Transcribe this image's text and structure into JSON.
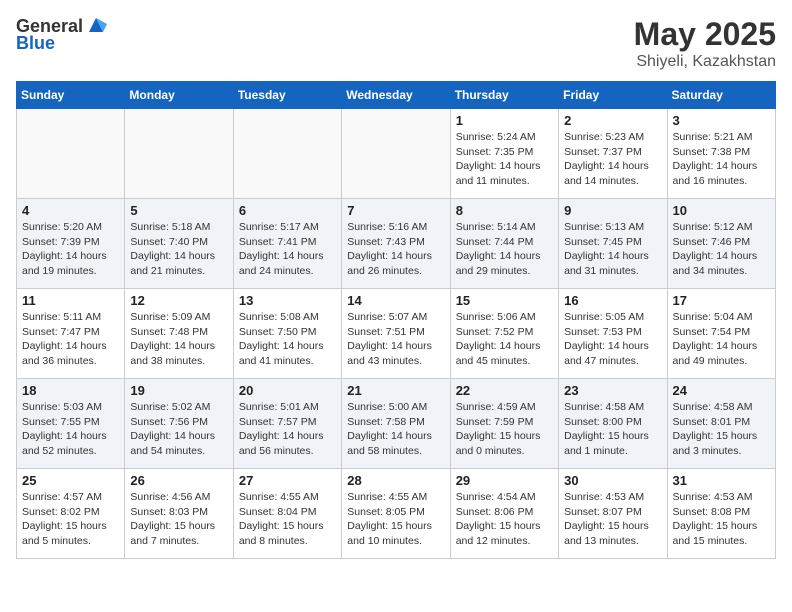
{
  "logo": {
    "text_general": "General",
    "text_blue": "Blue"
  },
  "title": "May 2025",
  "subtitle": "Shiyeli, Kazakhstan",
  "days_of_week": [
    "Sunday",
    "Monday",
    "Tuesday",
    "Wednesday",
    "Thursday",
    "Friday",
    "Saturday"
  ],
  "weeks": [
    [
      {
        "day": "",
        "info": ""
      },
      {
        "day": "",
        "info": ""
      },
      {
        "day": "",
        "info": ""
      },
      {
        "day": "",
        "info": ""
      },
      {
        "day": "1",
        "info": "Sunrise: 5:24 AM\nSunset: 7:35 PM\nDaylight: 14 hours\nand 11 minutes."
      },
      {
        "day": "2",
        "info": "Sunrise: 5:23 AM\nSunset: 7:37 PM\nDaylight: 14 hours\nand 14 minutes."
      },
      {
        "day": "3",
        "info": "Sunrise: 5:21 AM\nSunset: 7:38 PM\nDaylight: 14 hours\nand 16 minutes."
      }
    ],
    [
      {
        "day": "4",
        "info": "Sunrise: 5:20 AM\nSunset: 7:39 PM\nDaylight: 14 hours\nand 19 minutes."
      },
      {
        "day": "5",
        "info": "Sunrise: 5:18 AM\nSunset: 7:40 PM\nDaylight: 14 hours\nand 21 minutes."
      },
      {
        "day": "6",
        "info": "Sunrise: 5:17 AM\nSunset: 7:41 PM\nDaylight: 14 hours\nand 24 minutes."
      },
      {
        "day": "7",
        "info": "Sunrise: 5:16 AM\nSunset: 7:43 PM\nDaylight: 14 hours\nand 26 minutes."
      },
      {
        "day": "8",
        "info": "Sunrise: 5:14 AM\nSunset: 7:44 PM\nDaylight: 14 hours\nand 29 minutes."
      },
      {
        "day": "9",
        "info": "Sunrise: 5:13 AM\nSunset: 7:45 PM\nDaylight: 14 hours\nand 31 minutes."
      },
      {
        "day": "10",
        "info": "Sunrise: 5:12 AM\nSunset: 7:46 PM\nDaylight: 14 hours\nand 34 minutes."
      }
    ],
    [
      {
        "day": "11",
        "info": "Sunrise: 5:11 AM\nSunset: 7:47 PM\nDaylight: 14 hours\nand 36 minutes."
      },
      {
        "day": "12",
        "info": "Sunrise: 5:09 AM\nSunset: 7:48 PM\nDaylight: 14 hours\nand 38 minutes."
      },
      {
        "day": "13",
        "info": "Sunrise: 5:08 AM\nSunset: 7:50 PM\nDaylight: 14 hours\nand 41 minutes."
      },
      {
        "day": "14",
        "info": "Sunrise: 5:07 AM\nSunset: 7:51 PM\nDaylight: 14 hours\nand 43 minutes."
      },
      {
        "day": "15",
        "info": "Sunrise: 5:06 AM\nSunset: 7:52 PM\nDaylight: 14 hours\nand 45 minutes."
      },
      {
        "day": "16",
        "info": "Sunrise: 5:05 AM\nSunset: 7:53 PM\nDaylight: 14 hours\nand 47 minutes."
      },
      {
        "day": "17",
        "info": "Sunrise: 5:04 AM\nSunset: 7:54 PM\nDaylight: 14 hours\nand 49 minutes."
      }
    ],
    [
      {
        "day": "18",
        "info": "Sunrise: 5:03 AM\nSunset: 7:55 PM\nDaylight: 14 hours\nand 52 minutes."
      },
      {
        "day": "19",
        "info": "Sunrise: 5:02 AM\nSunset: 7:56 PM\nDaylight: 14 hours\nand 54 minutes."
      },
      {
        "day": "20",
        "info": "Sunrise: 5:01 AM\nSunset: 7:57 PM\nDaylight: 14 hours\nand 56 minutes."
      },
      {
        "day": "21",
        "info": "Sunrise: 5:00 AM\nSunset: 7:58 PM\nDaylight: 14 hours\nand 58 minutes."
      },
      {
        "day": "22",
        "info": "Sunrise: 4:59 AM\nSunset: 7:59 PM\nDaylight: 15 hours\nand 0 minutes."
      },
      {
        "day": "23",
        "info": "Sunrise: 4:58 AM\nSunset: 8:00 PM\nDaylight: 15 hours\nand 1 minute."
      },
      {
        "day": "24",
        "info": "Sunrise: 4:58 AM\nSunset: 8:01 PM\nDaylight: 15 hours\nand 3 minutes."
      }
    ],
    [
      {
        "day": "25",
        "info": "Sunrise: 4:57 AM\nSunset: 8:02 PM\nDaylight: 15 hours\nand 5 minutes."
      },
      {
        "day": "26",
        "info": "Sunrise: 4:56 AM\nSunset: 8:03 PM\nDaylight: 15 hours\nand 7 minutes."
      },
      {
        "day": "27",
        "info": "Sunrise: 4:55 AM\nSunset: 8:04 PM\nDaylight: 15 hours\nand 8 minutes."
      },
      {
        "day": "28",
        "info": "Sunrise: 4:55 AM\nSunset: 8:05 PM\nDaylight: 15 hours\nand 10 minutes."
      },
      {
        "day": "29",
        "info": "Sunrise: 4:54 AM\nSunset: 8:06 PM\nDaylight: 15 hours\nand 12 minutes."
      },
      {
        "day": "30",
        "info": "Sunrise: 4:53 AM\nSunset: 8:07 PM\nDaylight: 15 hours\nand 13 minutes."
      },
      {
        "day": "31",
        "info": "Sunrise: 4:53 AM\nSunset: 8:08 PM\nDaylight: 15 hours\nand 15 minutes."
      }
    ]
  ]
}
